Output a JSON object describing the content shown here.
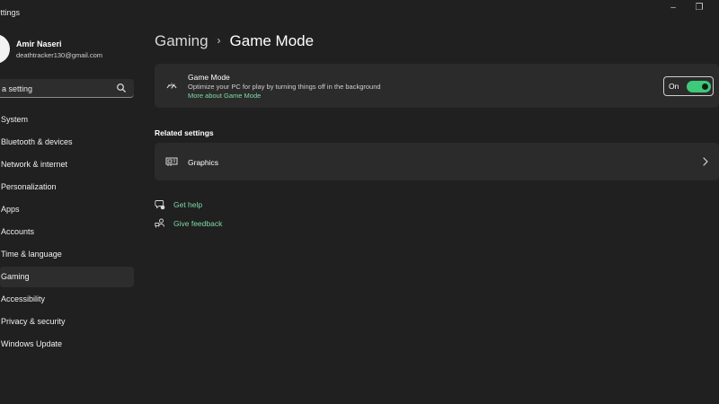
{
  "window": {
    "title": "Settings",
    "minimize_glyph": "–",
    "restore_glyph": "❐"
  },
  "user": {
    "name": "Amir Naseri",
    "email": "deathtracker130@gmail.com"
  },
  "search": {
    "placeholder": "Find a setting",
    "visible_text": "a setting",
    "icon": "search-icon"
  },
  "nav": {
    "items": [
      {
        "label": "System",
        "active": false
      },
      {
        "label": "Bluetooth & devices",
        "active": false
      },
      {
        "label": "Network & internet",
        "active": false
      },
      {
        "label": "Personalization",
        "active": false
      },
      {
        "label": "Apps",
        "active": false
      },
      {
        "label": "Accounts",
        "active": false
      },
      {
        "label": "Time & language",
        "active": false
      },
      {
        "label": "Gaming",
        "active": true
      },
      {
        "label": "Accessibility",
        "active": false
      },
      {
        "label": "Privacy & security",
        "active": false
      },
      {
        "label": "Windows Update",
        "active": false
      }
    ]
  },
  "breadcrumb": {
    "parent": "Gaming",
    "separator": "›",
    "current": "Game Mode"
  },
  "game_mode": {
    "icon": "gauge-icon",
    "title": "Game Mode",
    "description": "Optimize your PC for play by turning things off in the background",
    "link": "More about Game Mode",
    "toggle_label": "On",
    "toggle_on": true
  },
  "related": {
    "heading": "Related settings",
    "graphics_label": "Graphics",
    "graphics_icon": "graphics-card-icon"
  },
  "help": {
    "get_help": "Get help",
    "give_feedback": "Give feedback"
  },
  "colors": {
    "background": "#202020",
    "card": "#2b2b2b",
    "accent": "#7ed8a6",
    "toggle_on": "#3fc97a"
  }
}
